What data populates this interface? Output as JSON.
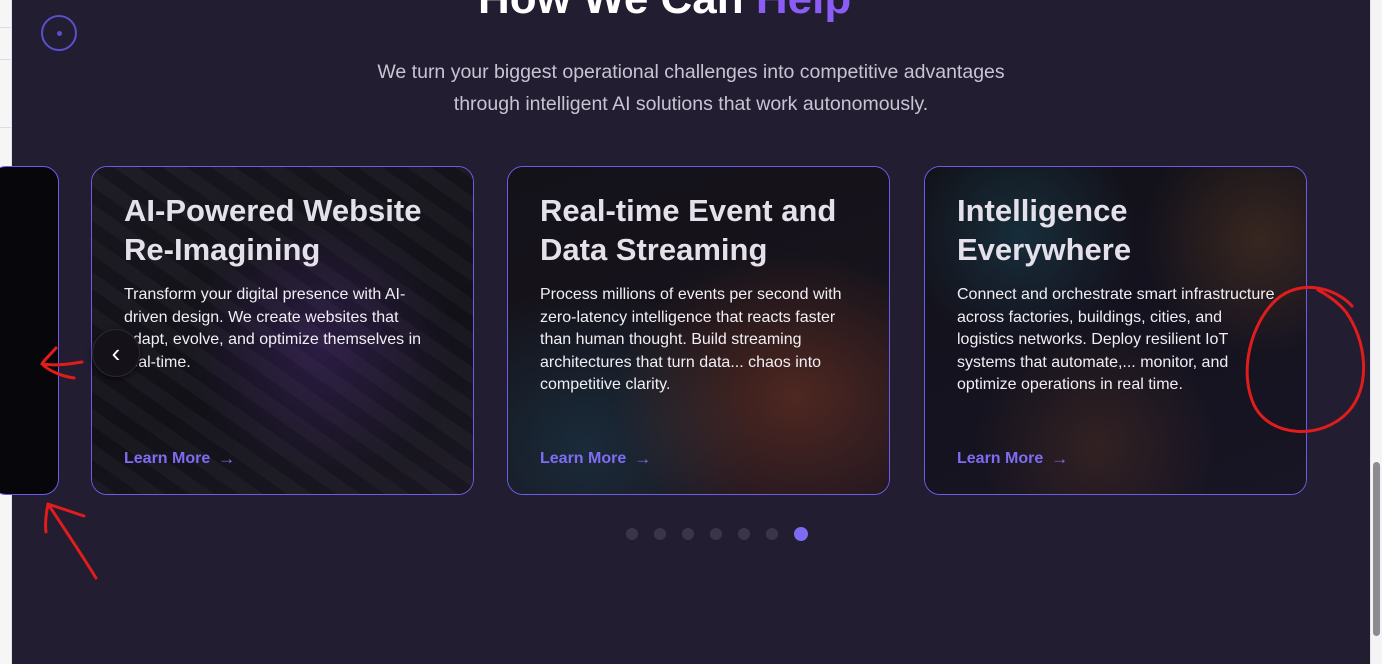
{
  "section": {
    "heading_main": "How We Can ",
    "heading_accent": "Help",
    "subtitle_line1": "We turn your biggest operational challenges into competitive advantages",
    "subtitle_line2": "through intelligent AI solutions that work autonomously."
  },
  "cards": [
    {
      "title": "AI-Powered Website Re-Imagining",
      "description": "Transform your digital presence with AI-driven design. We create websites that adapt, evolve, and optimize themselves in real-time.",
      "link": "Learn More"
    },
    {
      "title": "Real-time Event and Data Streaming",
      "description": "Process millions of events per second with zero-latency intelligence that reacts faster than human thought. Build streaming architectures that turn data... chaos into competitive clarity.",
      "link": "Learn More"
    },
    {
      "title": "Intelligence Everywhere",
      "description": "Connect and orchestrate smart infrastructure across factories, buildings, cities, and logistics networks. Deploy resilient IoT systems that automate,... monitor, and optimize operations in real time.",
      "link": "Learn More"
    }
  ],
  "carousel": {
    "prev_icon": "chevron-left-icon",
    "arrow_glyph": "→",
    "prev_glyph": "‹",
    "pagination": {
      "total": 7,
      "active_index": 6
    }
  },
  "colors": {
    "background": "#221d30",
    "accent": "#8b5cf6",
    "card_border": "#6c5ce7",
    "link": "#7e6cf3",
    "dot_inactive": "#3a3548",
    "dot_active": "#7c6cf3",
    "annotation": "#e01c1c"
  }
}
